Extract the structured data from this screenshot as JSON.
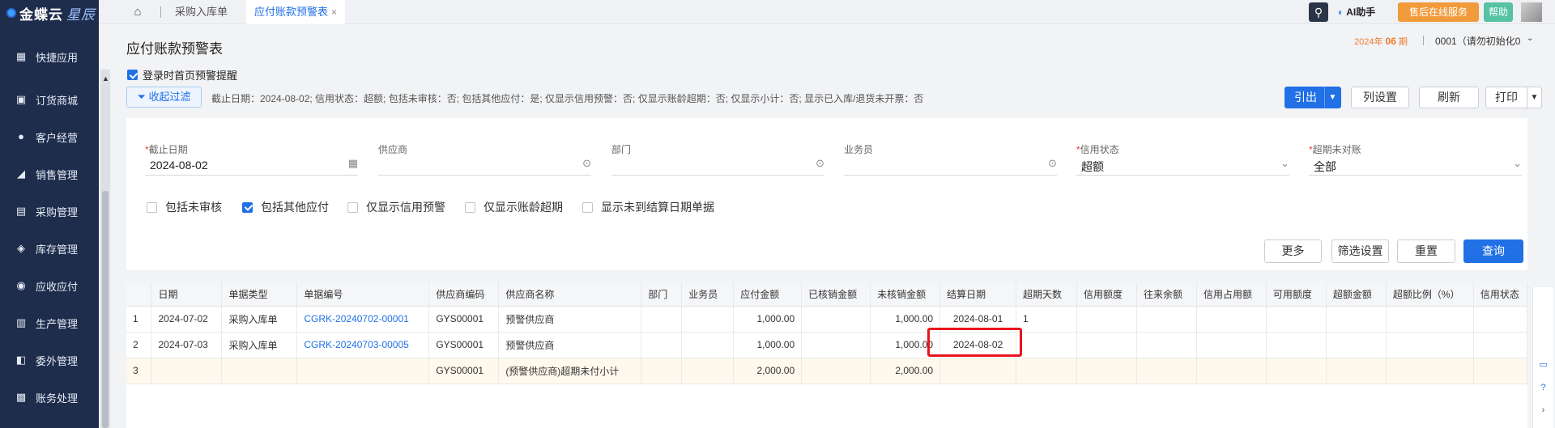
{
  "sidebar": {
    "logo": "金蝶云",
    "logo_tag": "星辰",
    "items": [
      {
        "label": "快捷应用",
        "icon": "grid-icon"
      },
      {
        "label": "订货商城",
        "icon": "shopping-bag-icon"
      },
      {
        "label": "客户经营",
        "icon": "user-icon"
      },
      {
        "label": "销售管理",
        "icon": "chart-icon"
      },
      {
        "label": "采购管理",
        "icon": "cart-icon"
      },
      {
        "label": "库存管理",
        "icon": "box-icon"
      },
      {
        "label": "应收应付",
        "icon": "coin-icon"
      },
      {
        "label": "生产管理",
        "icon": "factory-icon"
      },
      {
        "label": "委外管理",
        "icon": "handshake-icon"
      },
      {
        "label": "账务处理",
        "icon": "ledger-icon"
      }
    ]
  },
  "topbar": {
    "tabs": [
      {
        "label": "采购入库单"
      },
      {
        "label": "应付账款预警表"
      }
    ],
    "ai_label": "AI助手",
    "service_label": "售后在线服务",
    "help_label": "帮助"
  },
  "header": {
    "title": "应付账款预警表",
    "period_year": "2024年",
    "period_num": "06",
    "period_unit": "期",
    "org": "0001（请勿初始化0"
  },
  "remind": {
    "label": "登录时首页预警提醒",
    "checked": true
  },
  "filter_toggle_label": "收起过滤",
  "summary": "截止日期：2024-08-02; 信用状态：超额; 包括未审核：否; 包括其他应付：是; 仅显示信用预警：否; 仅显示账龄超期：否; 仅显示小计：否; 显示已入库/退货未开票：否",
  "actions": {
    "export": "引出",
    "layout": "列设置",
    "refresh": "刷新",
    "print": "打印"
  },
  "filters": {
    "fields": [
      {
        "label": "截止日期",
        "required": true,
        "value": "2024-08-02",
        "icon": "calendar-icon"
      },
      {
        "label": "供应商",
        "required": false,
        "value": "",
        "icon": "more-icon"
      },
      {
        "label": "部门",
        "required": false,
        "value": "",
        "icon": "more-icon"
      },
      {
        "label": "业务员",
        "required": false,
        "value": "",
        "icon": "more-icon"
      },
      {
        "label": "信用状态",
        "required": true,
        "value": "超额",
        "icon": "chevron-down-icon"
      },
      {
        "label": "超期未对账",
        "required": true,
        "value": "全部",
        "icon": "chevron-down-icon"
      }
    ],
    "checkboxes": [
      {
        "label": "包括未审核",
        "checked": false
      },
      {
        "label": "包括其他应付",
        "checked": true
      },
      {
        "label": "仅显示信用预警",
        "checked": false
      },
      {
        "label": "仅显示账龄超期",
        "checked": false
      },
      {
        "label": "显示未到结算日期单据",
        "checked": false
      }
    ],
    "buttons": {
      "more": "更多",
      "filter_settings": "筛选设置",
      "reset": "重置",
      "query": "查询"
    }
  },
  "table": {
    "columns": [
      "",
      "日期",
      "单据类型",
      "单据编号",
      "供应商编码",
      "供应商名称",
      "部门",
      "业务员",
      "应付金额",
      "已核销金额",
      "未核销金额",
      "结算日期",
      "超期天数",
      "信用额度",
      "往来余额",
      "信用占用额",
      "可用额度",
      "超额金额",
      "超额比例（%）",
      "信用状态"
    ],
    "rows": [
      [
        "1",
        "2024-07-02",
        "采购入库单",
        "CGRK-20240702-00001",
        "GYS00001",
        "预警供应商",
        "",
        "",
        "1,000.00",
        "",
        "1,000.00",
        "2024-08-01",
        "1",
        "",
        "",
        "",
        "",
        "",
        "",
        ""
      ],
      [
        "2",
        "2024-07-03",
        "采购入库单",
        "CGRK-20240703-00005",
        "GYS00001",
        "预警供应商",
        "",
        "",
        "1,000.00",
        "",
        "1,000.00",
        "2024-08-02",
        "",
        "",
        "",
        "",
        "",
        "",
        "",
        ""
      ],
      [
        "3",
        "",
        "",
        "",
        "GYS00001",
        "(预警供应商)超期未付小计",
        "",
        "",
        "2,000.00",
        "",
        "2,000.00",
        "",
        "",
        "",
        "",
        "",
        "",
        "",
        "",
        ""
      ]
    ]
  }
}
